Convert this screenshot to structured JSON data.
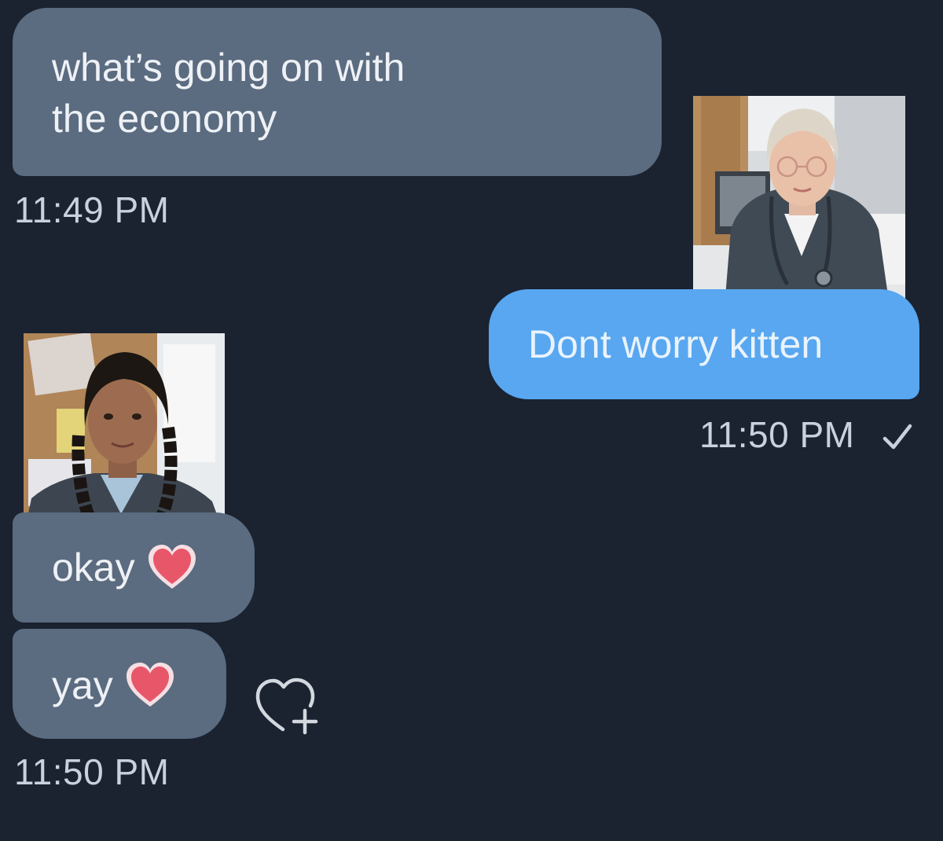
{
  "messages": [
    {
      "direction": "incoming",
      "lines": [
        "what’s going on with",
        "the economy"
      ]
    },
    {
      "direction": "outgoing",
      "text": "Dont worry kitten"
    },
    {
      "direction": "incoming",
      "text": "okay"
    },
    {
      "direction": "incoming",
      "text": "yay"
    }
  ],
  "timestamps": {
    "first": "11:49 PM",
    "second": "11:50 PM",
    "third": "11:50 PM"
  },
  "icons": {
    "read_receipt": "checkmark-icon",
    "message_heart": "heart-emoji-icon",
    "add_reaction": "heart-plus-icon"
  },
  "colors": {
    "background": "#1b2230",
    "incoming_bubble": "#5b6b80",
    "outgoing_bubble": "#58a7f0",
    "heart": "#e8566a"
  }
}
